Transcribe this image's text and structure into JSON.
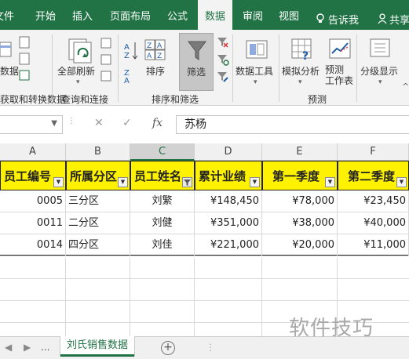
{
  "ribbon_tabs": [
    {
      "label": "文件"
    },
    {
      "label": "开始"
    },
    {
      "label": "插入"
    },
    {
      "label": "页面布局"
    },
    {
      "label": "公式"
    },
    {
      "label": "数据"
    },
    {
      "label": "审阅"
    },
    {
      "label": "视图"
    }
  ],
  "tell_me": "告诉我",
  "share": "共享",
  "ribbon": {
    "get_data_label": "数据",
    "refresh_all_label": "全部刷新",
    "sort_label": "排序",
    "filter_label": "筛选",
    "data_tools_label": "数据工具",
    "whatif_label": "模拟分析",
    "forecast_sheet_label": "预测\n工作表",
    "outline_label": "分级显示",
    "groups": {
      "get_transform": "获取和转换数据",
      "queries_connections": "查询和连接",
      "sort_filter": "排序和筛选",
      "forecast": "预测"
    }
  },
  "formula_bar": {
    "cancel_glyph": "✕",
    "enter_glyph": "✓",
    "fx_label": "fx",
    "value": "苏杨"
  },
  "columns": [
    "A",
    "B",
    "C",
    "D",
    "E",
    "F"
  ],
  "selected_column": "C",
  "headers": [
    "员工编号",
    "所属分区",
    "员工姓名",
    "累计业绩",
    "第一季度",
    "第二季度"
  ],
  "rows": [
    [
      "0005",
      "三分区",
      "刘繁",
      "¥148,450",
      "¥78,000",
      "¥23,450"
    ],
    [
      "0011",
      "二分区",
      "刘健",
      "¥351,000",
      "¥38,000",
      "¥40,000"
    ],
    [
      "0014",
      "四分区",
      "刘佳",
      "¥221,000",
      "¥20,000",
      "¥11,000"
    ]
  ],
  "sheet": {
    "nav_ellipsis": "...",
    "active_tab": "刘氏销售数据",
    "add_glyph": "+"
  },
  "watermark": "软件技巧",
  "colors": {
    "ribbon_green": "#217346",
    "header_fill": "#fff200"
  }
}
